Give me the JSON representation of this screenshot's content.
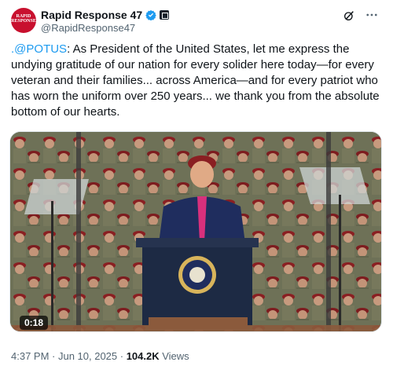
{
  "account": {
    "display_name": "Rapid Response 47",
    "handle": "@RapidResponse47",
    "avatar_text": "RAPID RESPONSE",
    "verified_color": "#1d9bf0",
    "avatar_color": "#c8102e"
  },
  "tweet": {
    "mention": ".@POTUS",
    "body": ": As President of the United States, let me express the undying gratitude of our nation for every solider here today—for every veteran and their families... across America—and for every patriot who has worn the uniform over 250 years... we thank you from the absolute bottom of our hearts."
  },
  "media": {
    "duration": "0:18",
    "icon": "video-thumbnail"
  },
  "meta": {
    "timestamp": "4:37 PM · Jun 10, 2025 · ",
    "views_count": "104.2K",
    "views_label": " Views"
  },
  "icons": {
    "verified": "verified-badge-icon",
    "affiliate": "affiliate-badge-icon",
    "grok": "grok-icon",
    "more": "more-options-icon"
  }
}
